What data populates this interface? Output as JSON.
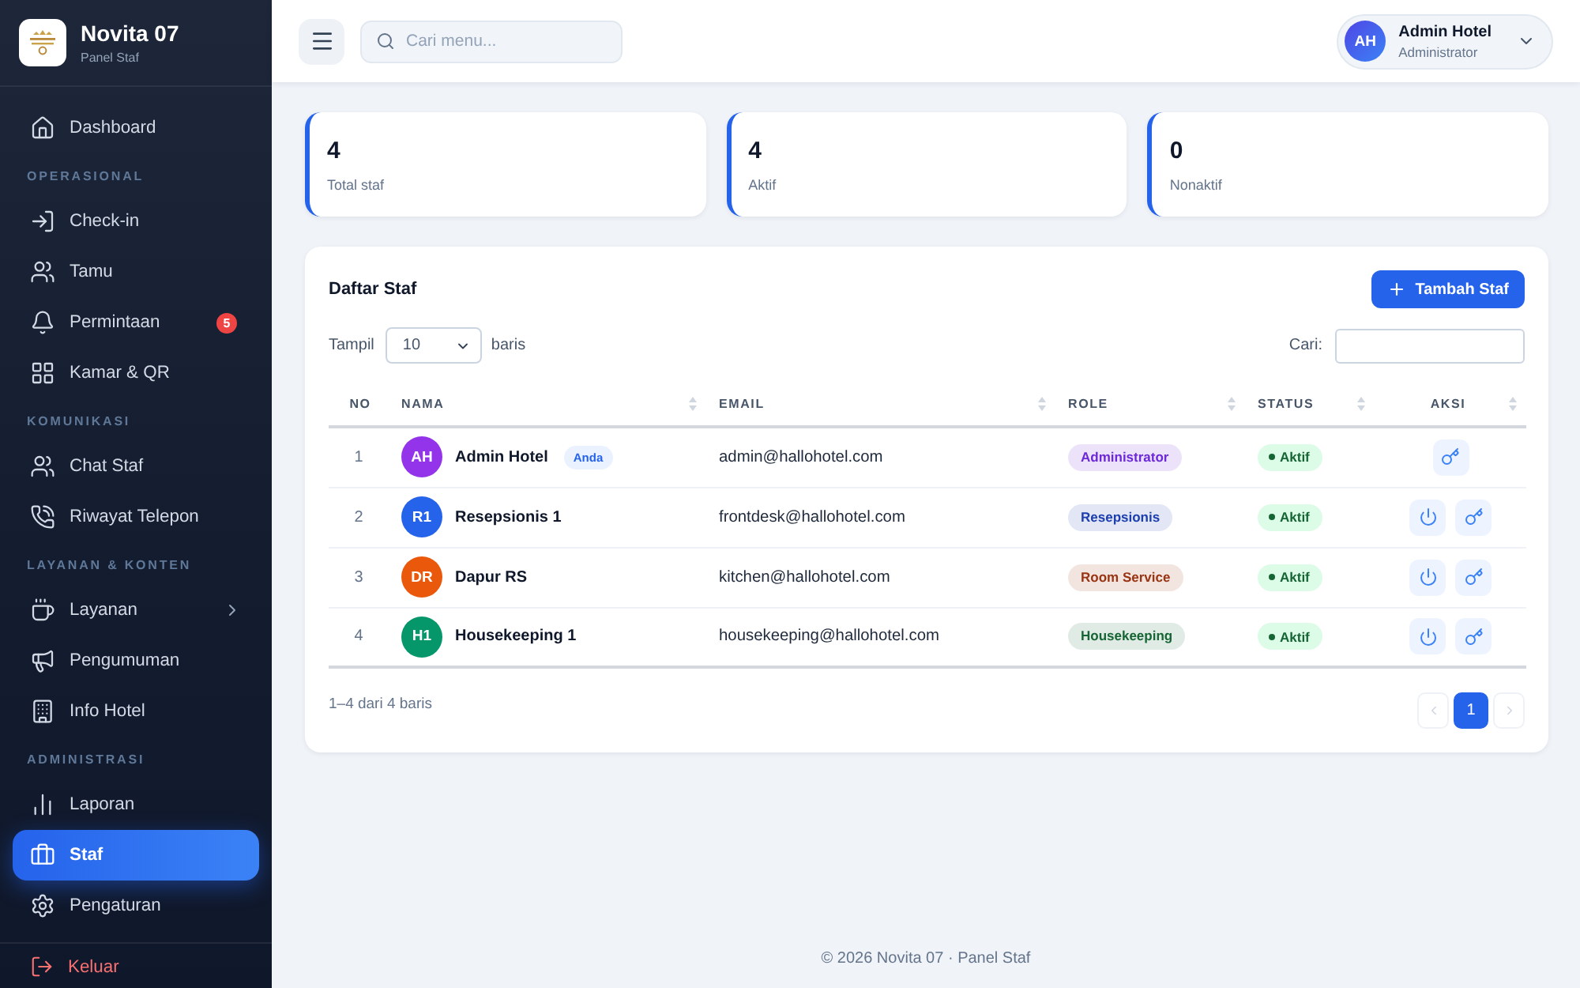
{
  "sidebar": {
    "brand": {
      "name": "Novita 07",
      "subtitle": "Panel Staf"
    },
    "groups": [
      {
        "items": [
          {
            "label": "Dashboard",
            "kind": "link",
            "selected": false
          }
        ]
      },
      {
        "heading": "OPERASIONAL",
        "items": [
          {
            "label": "Check-in",
            "kind": "link",
            "selected": false
          },
          {
            "label": "Tamu",
            "kind": "link",
            "selected": false
          },
          {
            "label": "Permintaan",
            "kind": "link",
            "selected": false,
            "badge": "5"
          },
          {
            "label": "Kamar & QR",
            "kind": "link",
            "selected": false
          }
        ]
      },
      {
        "heading": "KOMUNIKASI",
        "items": [
          {
            "label": "Chat Staf",
            "kind": "link",
            "selected": false
          },
          {
            "label": "Riwayat Telepon",
            "kind": "link",
            "selected": false
          }
        ]
      },
      {
        "heading": "LAYANAN & KONTEN",
        "items": [
          {
            "label": "Layanan",
            "kind": "submenu",
            "expanded": false,
            "selected": false
          },
          {
            "label": "Pengumuman",
            "kind": "link",
            "selected": false
          },
          {
            "label": "Info Hotel",
            "kind": "link",
            "selected": false
          }
        ]
      },
      {
        "heading": "ADMINISTRASI",
        "items": [
          {
            "label": "Laporan",
            "kind": "link",
            "selected": false
          },
          {
            "label": "Staf",
            "kind": "link",
            "selected": true
          },
          {
            "label": "Pengaturan",
            "kind": "link",
            "selected": false
          }
        ]
      }
    ],
    "logout": {
      "label": "Keluar"
    }
  },
  "topbar": {
    "search": {
      "placeholder": "Cari menu..."
    },
    "user": {
      "initials": "AH",
      "name": "Admin Hotel",
      "role": "Administrator"
    }
  },
  "stats": [
    {
      "value": "4",
      "label": "Total staf"
    },
    {
      "value": "4",
      "label": "Aktif"
    },
    {
      "value": "0",
      "label": "Nonaktif"
    }
  ],
  "staff_table": {
    "title": "Daftar Staf",
    "add_button": "Tambah Staf",
    "page_size": {
      "label": "Tampil",
      "value": "10",
      "suffix": "baris"
    },
    "search": {
      "label": "Cari:"
    },
    "columns": [
      {
        "label": "NO",
        "sortable": false
      },
      {
        "label": "NAMA",
        "sortable": true
      },
      {
        "label": "EMAIL",
        "sortable": true
      },
      {
        "label": "ROLE",
        "sortable": true
      },
      {
        "label": "STATUS",
        "sortable": true
      },
      {
        "label": "AKSI",
        "sortable": true
      }
    ],
    "rows": [
      {
        "no": "1",
        "avatar": {
          "initials": "AH",
          "color": "#9333ea"
        },
        "name": "Admin Hotel",
        "badge": "Anda",
        "email": "admin@hallohotel.com",
        "role": {
          "label": "Administrator",
          "color": "#6d28d9"
        },
        "status": {
          "label": "Aktif",
          "active": true
        },
        "actions": [
          {
            "kind": "key"
          }
        ]
      },
      {
        "no": "2",
        "avatar": {
          "initials": "R1",
          "color": "#2563eb"
        },
        "name": "Resepsionis 1",
        "email": "frontdesk@hallohotel.com",
        "role": {
          "label": "Resepsionis",
          "color": "#1e40af"
        },
        "status": {
          "label": "Aktif",
          "active": true
        },
        "actions": [
          {
            "kind": "power"
          },
          {
            "kind": "key"
          }
        ]
      },
      {
        "no": "3",
        "avatar": {
          "initials": "DR",
          "color": "#ea580c"
        },
        "name": "Dapur RS",
        "email": "kitchen@hallohotel.com",
        "role": {
          "label": "Room Service",
          "color": "#9a3412"
        },
        "status": {
          "label": "Aktif",
          "active": true
        },
        "actions": [
          {
            "kind": "power"
          },
          {
            "kind": "key"
          }
        ]
      },
      {
        "no": "4",
        "avatar": {
          "initials": "H1",
          "color": "#059669"
        },
        "name": "Housekeeping 1",
        "email": "housekeeping@hallohotel.com",
        "role": {
          "label": "Housekeeping",
          "color": "#166534"
        },
        "status": {
          "label": "Aktif",
          "active": true
        },
        "actions": [
          {
            "kind": "power"
          },
          {
            "kind": "key"
          }
        ]
      }
    ],
    "summary": "1–4 dari 4 baris",
    "pagination": {
      "prev": {
        "disabled": true
      },
      "pages": [
        {
          "label": "1",
          "selected": true
        }
      ],
      "next": {
        "disabled": true
      }
    }
  },
  "footer": "© 2026 Novita 07 · Panel Staf"
}
